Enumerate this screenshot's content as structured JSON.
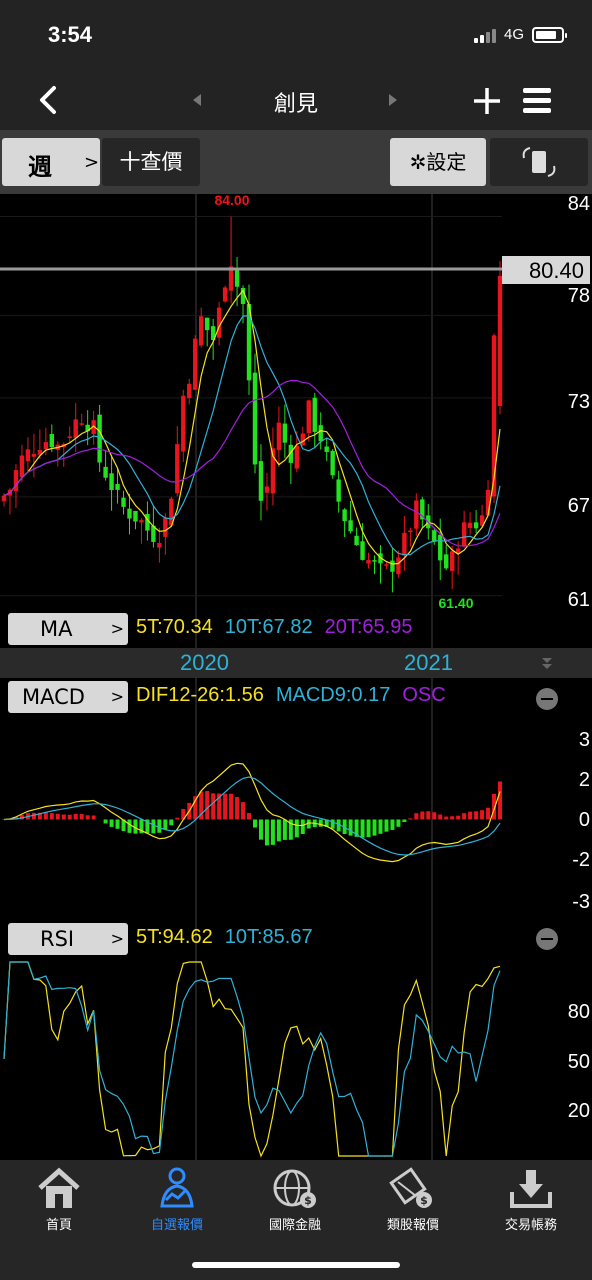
{
  "status": {
    "time": "3:54",
    "network": "4G"
  },
  "nav": {
    "title": "創見"
  },
  "toolbar": {
    "period": "週",
    "quote": "十查價",
    "settings": "設定"
  },
  "colors": {
    "up": "#e8141e",
    "down": "#22e21e",
    "ma5": "#f5e11e",
    "ma10": "#2fb2d7",
    "ma20": "#a21fe0",
    "price_line": "#9a9a9a",
    "accent": "#2d8cff"
  },
  "price_chart": {
    "high_label": "84.00",
    "low_label": "61.40",
    "current_price": "80.40",
    "y_ticks": [
      "84",
      "78",
      "73",
      "67",
      "61"
    ]
  },
  "ma": {
    "button": "MA",
    "ma5": "5T:70.34",
    "ma10": "10T:67.82",
    "ma20": "20T:65.95"
  },
  "years": {
    "y2020": "2020",
    "y2021": "2021"
  },
  "macd": {
    "button": "MACD",
    "dif": "DIF12-26:1.56",
    "macd9": "MACD9:0.17",
    "osc": "OSC",
    "y_ticks": [
      "3",
      "2",
      "0",
      "-2",
      "-3"
    ]
  },
  "rsi": {
    "button": "RSI",
    "rsi5": "5T:94.62",
    "rsi10": "10T:85.67",
    "y_ticks": [
      "80",
      "50",
      "20"
    ]
  },
  "tabs": [
    {
      "label": "首頁",
      "icon": "home-icon"
    },
    {
      "label": "自選報價",
      "icon": "watchlist-person-icon"
    },
    {
      "label": "國際金融",
      "icon": "globe-dollar-icon"
    },
    {
      "label": "類股報價",
      "icon": "sector-dollar-icon"
    },
    {
      "label": "交易帳務",
      "icon": "download-tray-icon"
    }
  ],
  "chart_data": {
    "type": "candlestick",
    "price_axis": {
      "ylim": [
        60.5,
        85
      ],
      "ticks": [
        84,
        78,
        73,
        67,
        61
      ],
      "high": 84.0,
      "low": 61.4,
      "last": 80.4
    },
    "moving_averages": [
      {
        "name": "5T",
        "last": 70.34
      },
      {
        "name": "10T",
        "last": 67.82
      },
      {
        "name": "20T",
        "last": 65.95
      }
    ],
    "x_year_labels": [
      "2020",
      "2021"
    ],
    "close_path": [
      [
        0,
        66.8
      ],
      [
        10,
        67.5
      ],
      [
        20,
        69.2
      ],
      [
        30,
        69.8
      ],
      [
        40,
        70.3
      ],
      [
        50,
        70.5
      ],
      [
        60,
        70.0
      ],
      [
        70,
        71.0
      ],
      [
        80,
        72.0
      ],
      [
        88,
        71.5
      ],
      [
        95,
        71.0
      ],
      [
        100,
        69.0
      ],
      [
        108,
        68.2
      ],
      [
        115,
        67.2
      ],
      [
        122,
        66.4
      ],
      [
        130,
        66.0
      ],
      [
        140,
        65.6
      ],
      [
        150,
        64.8
      ],
      [
        158,
        64.6
      ],
      [
        166,
        65.6
      ],
      [
        172,
        67.5
      ],
      [
        178,
        70.5
      ],
      [
        184,
        73.5
      ],
      [
        190,
        74.5
      ],
      [
        196,
        76.5
      ],
      [
        202,
        78.0
      ],
      [
        208,
        77.0
      ],
      [
        214,
        76.5
      ],
      [
        220,
        78.5
      ],
      [
        226,
        80.5
      ],
      [
        232,
        81.5
      ],
      [
        238,
        79.5
      ],
      [
        244,
        78.5
      ],
      [
        248,
        74.5
      ],
      [
        252,
        72.0
      ],
      [
        256,
        68.0
      ],
      [
        262,
        66.5
      ],
      [
        268,
        67.8
      ],
      [
        274,
        70.5
      ],
      [
        280,
        71.5
      ],
      [
        286,
        70.0
      ],
      [
        292,
        69.5
      ],
      [
        298,
        70.0
      ],
      [
        304,
        71.5
      ],
      [
        310,
        72.5
      ],
      [
        316,
        71.0
      ],
      [
        322,
        70.5
      ],
      [
        328,
        69.0
      ],
      [
        334,
        67.5
      ],
      [
        340,
        66.5
      ],
      [
        346,
        65.5
      ],
      [
        352,
        64.8
      ],
      [
        358,
        64.0
      ],
      [
        364,
        63.5
      ],
      [
        370,
        63.0
      ],
      [
        376,
        62.8
      ],
      [
        382,
        62.4
      ],
      [
        388,
        62.6
      ],
      [
        394,
        63.0
      ],
      [
        400,
        63.8
      ],
      [
        406,
        64.5
      ],
      [
        412,
        65.5
      ],
      [
        418,
        66.5
      ],
      [
        424,
        65.2
      ],
      [
        430,
        64.5
      ],
      [
        436,
        64.0
      ],
      [
        442,
        63.0
      ],
      [
        448,
        62.6
      ],
      [
        454,
        63.5
      ],
      [
        460,
        64.8
      ],
      [
        466,
        65.2
      ],
      [
        472,
        65.6
      ],
      [
        478,
        65.3
      ],
      [
        484,
        66.0
      ],
      [
        490,
        69.0
      ],
      [
        496,
        80.4
      ]
    ],
    "macd": {
      "ylim": [
        -3.2,
        3.3
      ],
      "ticks": [
        3,
        2,
        0,
        -2,
        -3
      ],
      "dif_last": 1.56,
      "macd9_last": 0.17
    },
    "rsi": {
      "ylim": [
        0,
        100
      ],
      "ticks": [
        80,
        50,
        20
      ],
      "rsi5_last": 94.62,
      "rsi10_last": 85.67
    }
  }
}
